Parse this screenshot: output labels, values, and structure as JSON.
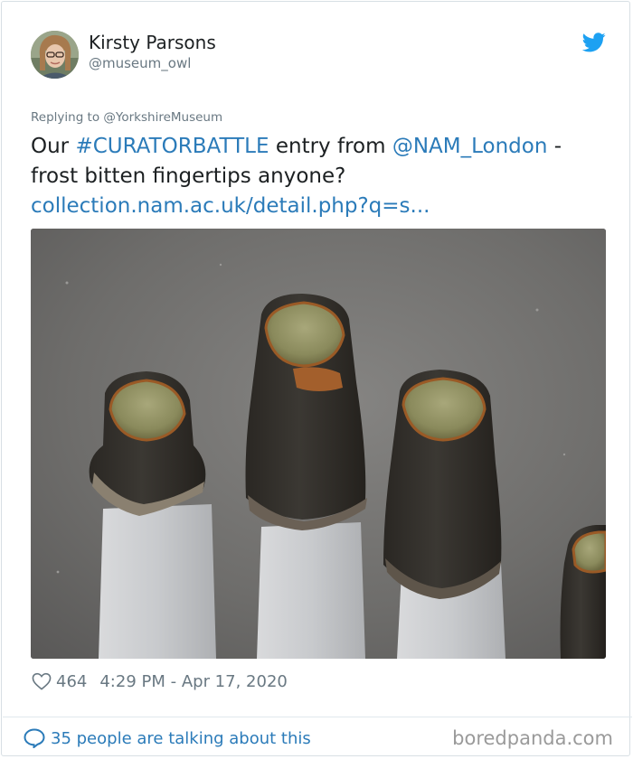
{
  "author": {
    "name": "Kirsty Parsons",
    "handle": "@museum_owl"
  },
  "tweet": {
    "replying_to": "Replying to @YorkshireMuseum",
    "text_before": "Our ",
    "hashtag": "#CURATORBATTLE",
    "text_mid": " entry from ",
    "mention": "@NAM_London",
    "text_after": " - frost bitten fingertips anyone?",
    "url_text": "collection.nam.ac.uk/detail.php?q=s..."
  },
  "meta": {
    "likes": "464",
    "timestamp": "4:29 PM - Apr 17, 2020"
  },
  "footer": {
    "talking": "35 people are talking about this",
    "watermark": "boredpanda.com"
  },
  "colors": {
    "link": "#2b7bb9",
    "text": "#1c2022",
    "muted": "#697882",
    "twitter_blue": "#1da1f2"
  },
  "icons": {
    "logo": "twitter-bird-icon",
    "like": "heart-icon",
    "reply": "speech-bubble-icon"
  }
}
